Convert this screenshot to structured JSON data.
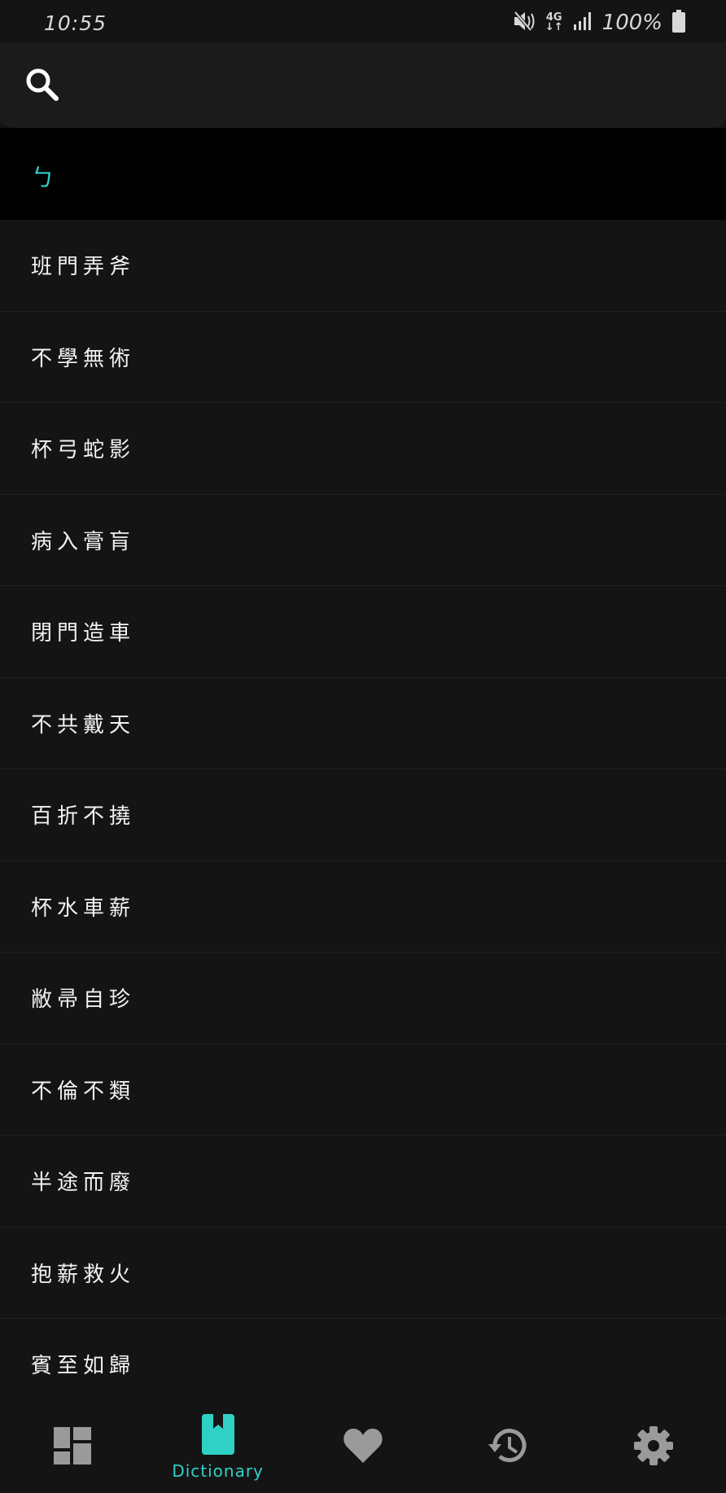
{
  "status_bar": {
    "time": "10:55",
    "network": "4G",
    "battery": "100%"
  },
  "search": {
    "icon": "search-icon"
  },
  "section": {
    "letter": "ㄅ",
    "accent_color": "#2fd1c7"
  },
  "entries": [
    "班門弄斧",
    "不學無術",
    "杯弓蛇影",
    "病入膏肓",
    "閉門造車",
    "不共戴天",
    "百折不撓",
    "杯水車薪",
    "敝帚自珍",
    "不倫不類",
    "半途而廢",
    "抱薪救火",
    "賓至如歸"
  ],
  "bottom_nav": {
    "items": [
      {
        "icon": "dashboard-icon",
        "label": ""
      },
      {
        "icon": "dictionary-icon",
        "label": "Dictionary",
        "active": true
      },
      {
        "icon": "heart-icon",
        "label": ""
      },
      {
        "icon": "history-icon",
        "label": ""
      },
      {
        "icon": "gear-icon",
        "label": ""
      }
    ]
  }
}
